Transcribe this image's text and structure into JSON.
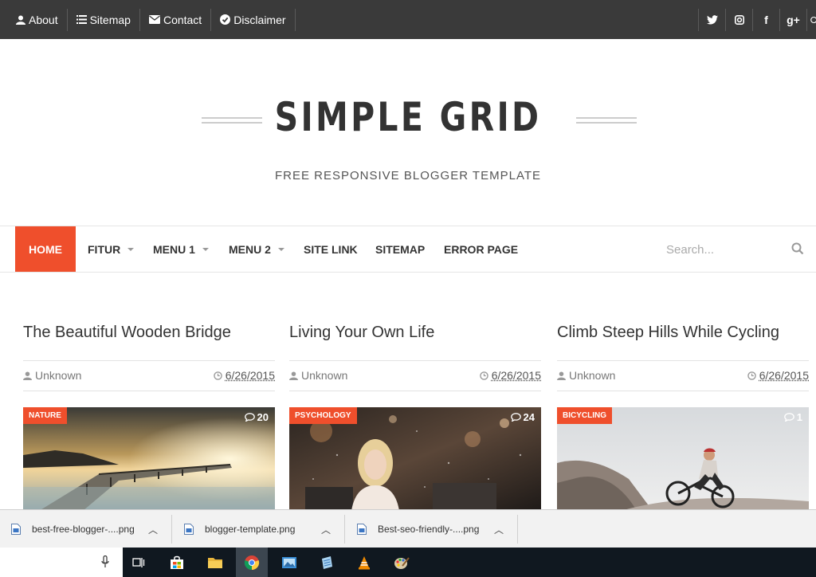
{
  "topbar": {
    "links": [
      {
        "label": "About",
        "icon": "user-icon"
      },
      {
        "label": "Sitemap",
        "icon": "list-icon"
      },
      {
        "label": "Contact",
        "icon": "envelope-icon"
      },
      {
        "label": "Disclaimer",
        "icon": "check-circle-icon"
      }
    ],
    "social": [
      "twitter-icon",
      "instagram-icon",
      "facebook-icon",
      "google-plus-icon",
      "pinterest-icon"
    ],
    "social_glyphs": {
      "facebook": "f",
      "google_plus": "g+"
    }
  },
  "header": {
    "title": "SIMPLE GRID",
    "tagline": "FREE RESPONSIVE BLOGGER TEMPLATE"
  },
  "nav": {
    "home": "HOME",
    "items": [
      {
        "label": "FITUR",
        "dropdown": true
      },
      {
        "label": "MENU 1",
        "dropdown": true
      },
      {
        "label": "MENU 2",
        "dropdown": true
      },
      {
        "label": "SITE LINK",
        "dropdown": false
      },
      {
        "label": "SITEMAP",
        "dropdown": false
      },
      {
        "label": "ERROR PAGE",
        "dropdown": false
      }
    ],
    "search_placeholder": "Search..."
  },
  "posts": [
    {
      "title": "The Beautiful Wooden Bridge",
      "author": "Unknown",
      "date": "6/26/2015",
      "label": "NATURE",
      "comments": "20"
    },
    {
      "title": "Living Your Own Life",
      "author": "Unknown",
      "date": "6/26/2015",
      "label": "PSYCHOLOGY",
      "comments": "24"
    },
    {
      "title": "Climb Steep Hills While Cycling",
      "author": "Unknown",
      "date": "6/26/2015",
      "label": "BICYCLING",
      "comments": "1"
    }
  ],
  "downloads": [
    {
      "name": "best-free-blogger-....png"
    },
    {
      "name": "blogger-template.png"
    },
    {
      "name": "Best-seo-friendly-....png"
    }
  ],
  "colors": {
    "accent": "#ef4f2c",
    "topbar": "#3a3a3a",
    "text": "#333333"
  }
}
